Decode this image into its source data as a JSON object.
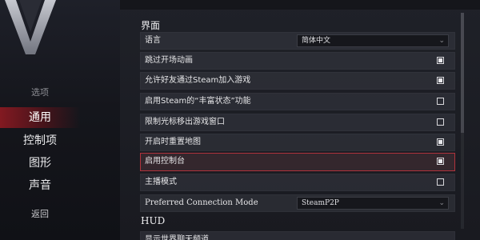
{
  "menu": {
    "heading": "选项",
    "items": [
      {
        "label": "通用",
        "active": true
      },
      {
        "label": "控制项",
        "active": false
      },
      {
        "label": "图形",
        "active": false
      },
      {
        "label": "声音",
        "active": false
      }
    ],
    "back_label": "返回"
  },
  "colors": {
    "accent": "#b0333c",
    "active_bg": "#961a22"
  },
  "settings": {
    "section_interface": "界面",
    "language": {
      "label": "语言",
      "value": "简体中文",
      "icon": "chevron-down-icon"
    },
    "skip_intro": {
      "label": "跳过开场动画",
      "checked": true
    },
    "allow_join": {
      "label": "允许好友通过Steam加入游戏",
      "checked": true
    },
    "rich_presence": {
      "label": "启用Steam的“丰富状态”功能",
      "checked": false
    },
    "confine_cursor": {
      "label": "限制光标移出游戏窗口",
      "checked": false
    },
    "reset_map": {
      "label": "开启时重置地图",
      "checked": true
    },
    "console": {
      "label": "启用控制台",
      "checked": true
    },
    "streamer_mode": {
      "label": "主播模式",
      "checked": false
    },
    "connection_mode": {
      "label": "Preferred Connection Mode",
      "value": "SteamP2P",
      "icon": "chevron-down-icon"
    },
    "section_hud": "HUD",
    "partial_row": {
      "label": "显示世界聊天频道"
    }
  }
}
